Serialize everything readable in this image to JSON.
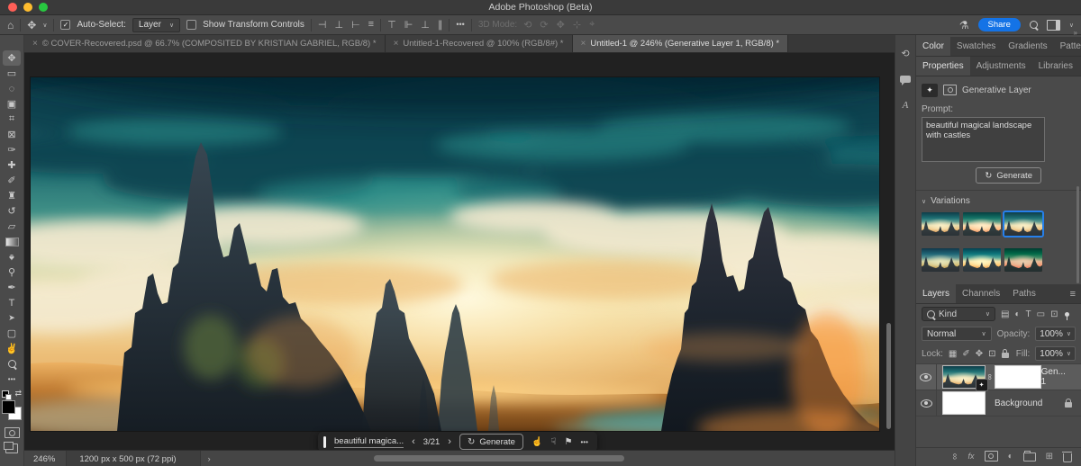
{
  "window": {
    "title": "Adobe Photoshop (Beta)"
  },
  "icons": {
    "close": "×",
    "check": "✓",
    "chevron_down": "∨",
    "chevron_left": "‹",
    "chevron_right": "›",
    "collapse": "»",
    "menu": "≡",
    "ellipsis": "•••",
    "home": "⌂",
    "move": "✥",
    "marquee": "▭",
    "lasso": "◌",
    "object_select": "▣",
    "crop": "⌗",
    "frame": "⊠",
    "eyedropper": "✑",
    "healing": "✚",
    "brush": "✐",
    "clone_stamp": "♜",
    "history_brush": "↺",
    "eraser": "▱",
    "blur": "♠",
    "dodge": "⚲",
    "pen": "✒",
    "type": "T",
    "path_select": "➤",
    "shape": "▢",
    "hand": "✌",
    "swap": "⇄",
    "align_left": "⊣",
    "align_center_h": "⊥",
    "align_right": "⊢",
    "distribute_h": "≡",
    "align_top": "⊤",
    "align_middle": "⊩",
    "align_bottom": "⊥",
    "distribute_v": "∥",
    "orbit_3d": "⟲",
    "roll_3d": "⟳",
    "pan_3d": "✥",
    "slide_3d": "⊹",
    "camera_3d": "⌖",
    "flask": "⚗",
    "link": "∞",
    "fx": "fx",
    "half_circle": "◐",
    "new_layer": "⊞",
    "sparkle": "✦",
    "regenerate": "↻",
    "thumb_up": "☝",
    "thumb_down": "☟",
    "flag": "⚑",
    "filter_pixel": "▤",
    "filter_type": "T",
    "filter_shape": "▭",
    "filter_smart": "⊡",
    "lock_checker": "▦",
    "history_panel": "⟲",
    "character_panel": "A"
  },
  "options_bar": {
    "auto_select_label": "Auto-Select:",
    "auto_select_value": "Layer",
    "show_transform_label": "Show Transform Controls",
    "mode_3d_label": "3D Mode:",
    "share_label": "Share"
  },
  "doc_tabs": [
    {
      "label": "© COVER-Recovered.psd @ 66.7% (COMPOSITED BY KRISTIAN GABRIEL, RGB/8) *"
    },
    {
      "label": "Untitled-1-Recovered @ 100% (RGB/8#) *"
    },
    {
      "label": "Untitled-1 @ 246% (Generative Layer 1, RGB/8) *"
    }
  ],
  "panels": {
    "color_group": {
      "tabs": [
        "Color",
        "Swatches",
        "Gradients",
        "Patterns"
      ]
    },
    "properties_group": {
      "tabs": [
        "Properties",
        "Adjustments",
        "Libraries"
      ]
    },
    "properties": {
      "layer_type": "Generative Layer",
      "prompt_label": "Prompt:",
      "prompt_value": "beautiful magical landscape with castles",
      "generate_label": "Generate",
      "variations_label": "Variations"
    },
    "layers_group": {
      "tabs": [
        "Layers",
        "Channels",
        "Paths"
      ]
    },
    "layers": {
      "filter_value": "Kind",
      "blend_mode": "Normal",
      "opacity_label": "Opacity:",
      "opacity_value": "100%",
      "lock_label": "Lock:",
      "fill_label": "Fill:",
      "fill_value": "100%",
      "items": [
        {
          "name": "Gen... 1"
        },
        {
          "name": "Background"
        }
      ]
    }
  },
  "task_bar": {
    "prompt_preview": "beautiful magica...",
    "counter": "3/21",
    "generate_label": "Generate"
  },
  "status_bar": {
    "zoom": "246%",
    "doc_info": "1200 px x 500 px (72 ppi)"
  },
  "colors": {
    "accent_blue": "#1473e6",
    "selection_blue": "#2680eb"
  }
}
